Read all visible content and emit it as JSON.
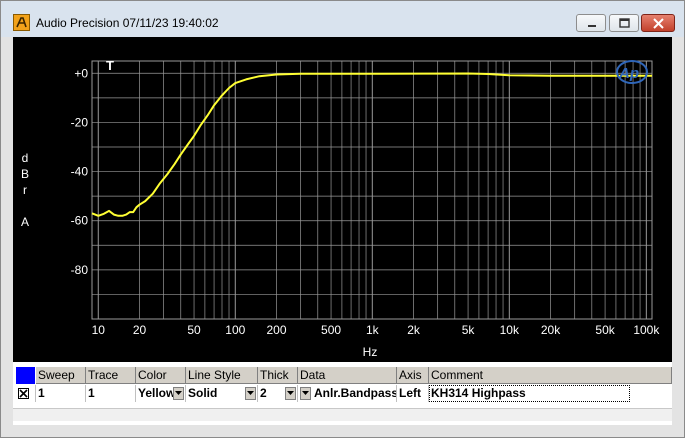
{
  "window": {
    "title": "Audio Precision  07/11/23 19:40:02",
    "app_icon": "ap-logo-icon",
    "controls": [
      "minimize-icon",
      "maximize-icon",
      "close-icon"
    ]
  },
  "graph": {
    "marker": "T",
    "brand_logo": "Ap",
    "colors": {
      "background": "#000000",
      "grid": "#9a9a9a",
      "trace": "#ffff33",
      "text": "#ffffff",
      "logo": "#2f66b9"
    }
  },
  "chart_data": {
    "type": "line",
    "xlabel": "Hz",
    "ylabel": "dBr A",
    "ylabel_lines": [
      "d",
      "B",
      "r",
      "",
      "A"
    ],
    "x_scale": "log",
    "xlim": [
      9,
      110000
    ],
    "ylim": [
      -100,
      5
    ],
    "grid": true,
    "x_ticks": [
      {
        "value": 10,
        "label": "10"
      },
      {
        "value": 20,
        "label": "20"
      },
      {
        "value": 50,
        "label": "50"
      },
      {
        "value": 100,
        "label": "100"
      },
      {
        "value": 200,
        "label": "200"
      },
      {
        "value": 500,
        "label": "500"
      },
      {
        "value": 1000,
        "label": "1k"
      },
      {
        "value": 2000,
        "label": "2k"
      },
      {
        "value": 5000,
        "label": "5k"
      },
      {
        "value": 10000,
        "label": "10k"
      },
      {
        "value": 20000,
        "label": "20k"
      },
      {
        "value": 50000,
        "label": "50k"
      },
      {
        "value": 100000,
        "label": "100k"
      }
    ],
    "y_ticks": [
      {
        "value": 0,
        "label": "+0"
      },
      {
        "value": -20,
        "label": "-20"
      },
      {
        "value": -40,
        "label": "-40"
      },
      {
        "value": -60,
        "label": "-60"
      },
      {
        "value": -80,
        "label": "-80"
      }
    ],
    "series": [
      {
        "color": "#ffff33",
        "x": [
          9,
          10,
          11,
          12,
          13,
          14,
          15,
          16,
          17,
          18,
          19,
          20,
          22,
          25,
          28,
          32,
          36,
          40,
          45,
          50,
          56,
          63,
          70,
          80,
          90,
          100,
          120,
          150,
          200,
          300,
          1000,
          5000,
          7000,
          10000,
          20000,
          50000,
          110000
        ],
        "y": [
          -57,
          -58,
          -57.2,
          -56,
          -57.5,
          -58,
          -58,
          -57.5,
          -56.5,
          -56.5,
          -54.5,
          -53.5,
          -52,
          -49,
          -45,
          -41,
          -37,
          -33,
          -29,
          -25.5,
          -21,
          -17,
          -13,
          -9,
          -6,
          -4,
          -2.5,
          -1.2,
          -0.5,
          -0.2,
          -0.2,
          -0.1,
          -0.3,
          -0.8,
          -1.0,
          -1.0,
          -1.0
        ]
      }
    ]
  },
  "sweep_table": {
    "selector_color": "#0000ff",
    "columns": [
      "Sweep",
      "Trace",
      "Color",
      "Line Style",
      "Thick",
      "Data",
      "Axis",
      "Comment"
    ],
    "rows": [
      {
        "enabled_mark": "✕",
        "sweep": "1",
        "trace": "1",
        "color": "Yellow",
        "line_style": "Solid",
        "thick": "2",
        "data": "Anlr.Bandpass",
        "axis": "Left",
        "comment": "KH314 Highpass"
      }
    ]
  }
}
